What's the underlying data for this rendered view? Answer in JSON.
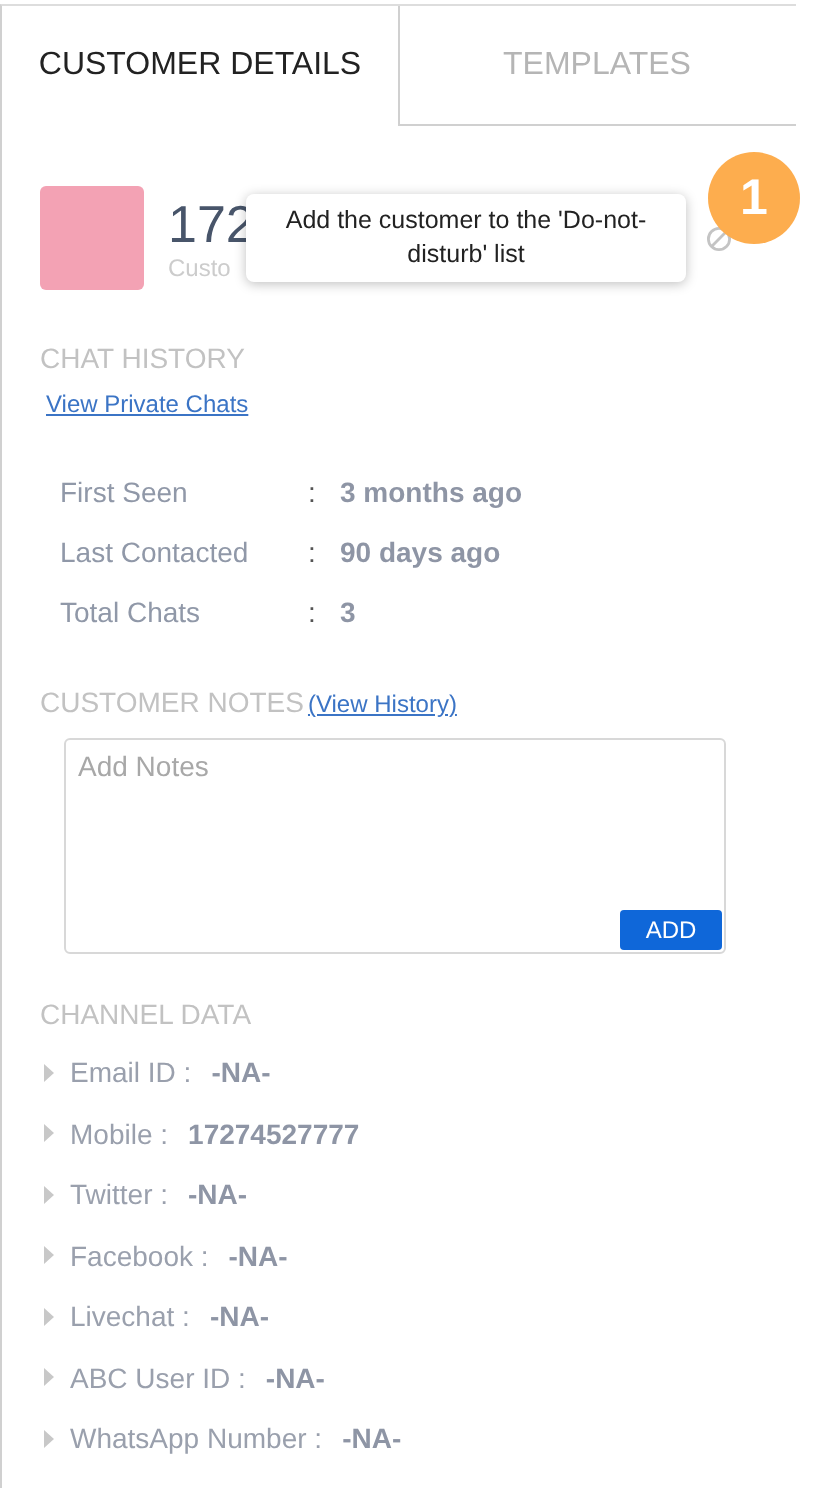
{
  "tabs": [
    {
      "label": "CUSTOMER DETAILS",
      "selected": true
    },
    {
      "label": "TEMPLATES",
      "selected": false
    }
  ],
  "customer": {
    "name": "172",
    "customer_id": "Custo",
    "badge": "1",
    "tooltip": "Add the customer to the 'Do-not-disturb' list"
  },
  "chat_history": {
    "title": "CHAT HISTORY",
    "link": "View Private Chats",
    "stats": [
      {
        "label": "First Seen",
        "colon": ":",
        "value": "3 months ago"
      },
      {
        "label": "Last Contacted",
        "colon": ":",
        "value": "90 days ago"
      },
      {
        "label": "Total Chats",
        "colon": ":",
        "value": "3"
      }
    ]
  },
  "customer_notes": {
    "title": "CUSTOMER NOTES",
    "link": "(View History)",
    "placeholder": "Add Notes",
    "button": "ADD"
  },
  "channel_data": {
    "title": "CHANNEL DATA",
    "items": [
      {
        "label": "Email ID :",
        "value": "-NA-"
      },
      {
        "label": "Mobile :",
        "value": "17274527777"
      },
      {
        "label": "Twitter :",
        "value": "-NA-"
      },
      {
        "label": "Facebook :",
        "value": "-NA-"
      },
      {
        "label": "Livechat :",
        "value": "-NA-"
      },
      {
        "label": "ABC User ID :",
        "value": "-NA-"
      },
      {
        "label": "WhatsApp Number :",
        "value": "-NA-"
      }
    ]
  }
}
